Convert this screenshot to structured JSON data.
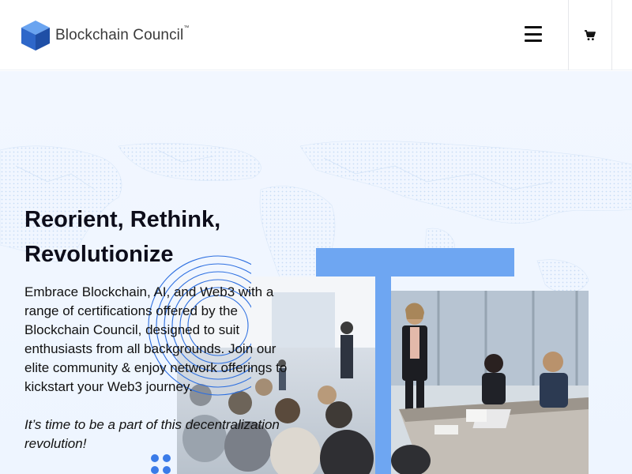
{
  "header": {
    "logo_text": "Blockchain Council",
    "logo_tm": "™",
    "menu_icon": "hamburger-menu-icon",
    "cart_icon": "shopping-cart-icon"
  },
  "hero": {
    "headline": "Reorient, Rethink, Revolutionize",
    "description": "Embrace Blockchain, AI, and Web3 with a range of certifications offered by the Blockchain Council, designed to suit enthusiasts from all backgrounds. Join our elite community & enjoy network offerings to kickstart your Web3 journey.",
    "tagline": "It’s time to be a part of this decentralization revolution!"
  },
  "colors": {
    "accent_blue": "#6ea6f2",
    "logo_blue": "#2f6fd6",
    "hero_bg": "#f2f7ff"
  }
}
